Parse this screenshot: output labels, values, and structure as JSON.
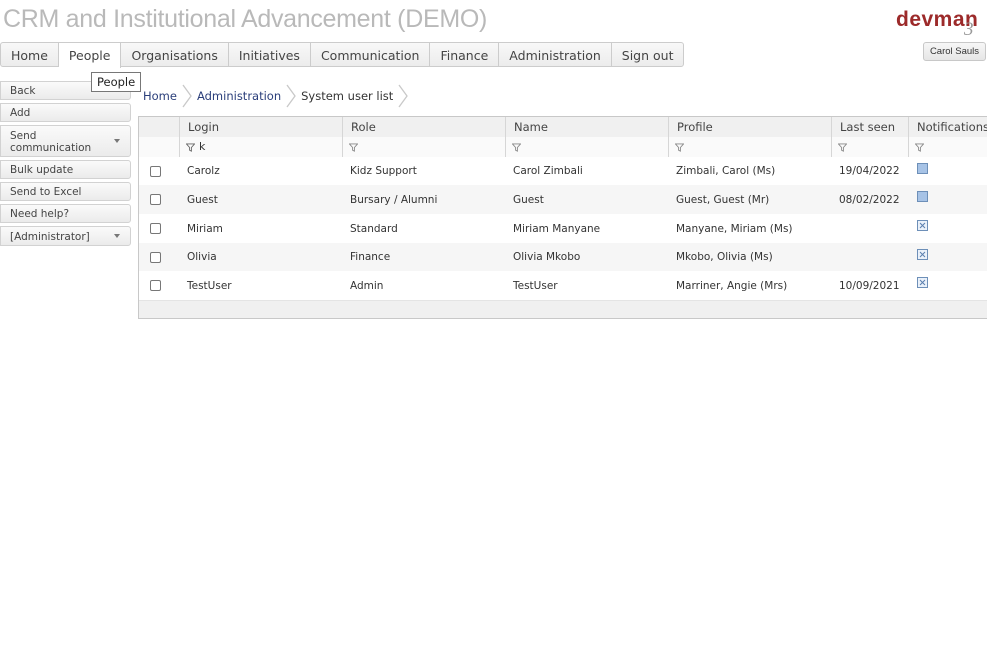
{
  "app": {
    "title": "CRM and Institutional Advancement (DEMO)",
    "logo_text": "devman",
    "logo_number": "3",
    "user_button": "Carol Sauls"
  },
  "menu": {
    "items": [
      "Home",
      "People",
      "Organisations",
      "Initiatives",
      "Communication",
      "Finance",
      "Administration",
      "Sign out"
    ],
    "active": "People",
    "tooltip": "People"
  },
  "sidebar": {
    "buttons": [
      "Back",
      "Add",
      "Send communication",
      "Bulk update",
      "Send to Excel",
      "Need help?",
      "[Administrator]"
    ],
    "send_line1": "Send",
    "send_line2": "communication"
  },
  "breadcrumb": [
    "Home",
    "Administration",
    "System user list"
  ],
  "grid": {
    "columns": [
      "Login",
      "Role",
      "Name",
      "Profile",
      "Last seen",
      "Notifications"
    ],
    "filters": {
      "login": "k"
    },
    "rows": [
      {
        "login": "Carolz",
        "role": "Kidz Support",
        "name": "Carol Zimbali",
        "profile": "Zimbali, Carol (Ms)",
        "last_seen": "19/04/2022",
        "notifications": "enabled"
      },
      {
        "login": "Guest",
        "role": "Bursary / Alumni",
        "name": "Guest",
        "profile": "Guest, Guest (Mr)",
        "last_seen": "08/02/2022",
        "notifications": "enabled"
      },
      {
        "login": "Miriam",
        "role": "Standard",
        "name": "Miriam Manyane",
        "profile": "Manyane, Miriam (Ms)",
        "last_seen": "",
        "notifications": "disabled"
      },
      {
        "login": "Olivia",
        "role": "Finance",
        "name": "Olivia Mkobo",
        "profile": "Mkobo, Olivia (Ms)",
        "last_seen": "",
        "notifications": "disabled"
      },
      {
        "login": "TestUser",
        "role": "Admin",
        "name": "TestUser",
        "profile": "Marriner, Angie (Mrs)",
        "last_seen": "10/09/2021",
        "notifications": "disabled"
      }
    ]
  },
  "colors": {
    "title_gray": "#b9b9b9",
    "logo_red": "#9c2a2a",
    "link_blue": "#2a3e7a",
    "notification_blue": "#a7c3e6"
  }
}
